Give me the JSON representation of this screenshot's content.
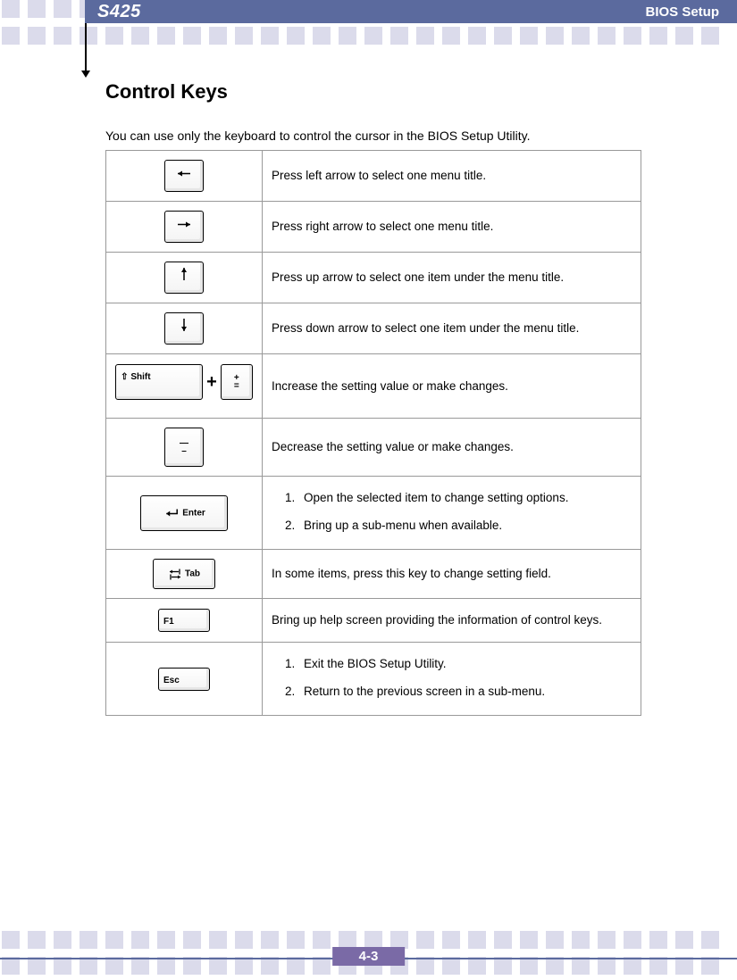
{
  "header": {
    "model": "S425",
    "section": "BIOS Setup"
  },
  "heading": "Control Keys",
  "intro": "You can use only the keyboard to control the cursor in the BIOS Setup Utility.",
  "rows": {
    "left": "Press left arrow to select one menu title.",
    "right": "Press right arrow to select one menu title.",
    "up": "Press up arrow to select one item under the menu title.",
    "down": "Press down arrow to select one item under the menu title.",
    "plus": "Increase the setting value or make changes.",
    "minus": "Decrease the setting value or make changes.",
    "enter1": "Open the selected item to change setting options.",
    "enter2": "Bring up a sub-menu when available.",
    "tab": "In some items, press this key to change setting field.",
    "f1": "Bring up help screen providing the information of control keys.",
    "esc1": "Exit the BIOS Setup Utility.",
    "esc2": "Return to the previous screen in a sub-menu."
  },
  "keylabels": {
    "shift": "Shift",
    "enter": "Enter",
    "tab": "Tab",
    "f1": "F1",
    "esc": "Esc",
    "plus_top": "+",
    "plus_bot": "=",
    "minus_top": "—",
    "minus_bot": "–"
  },
  "page": "4-3"
}
